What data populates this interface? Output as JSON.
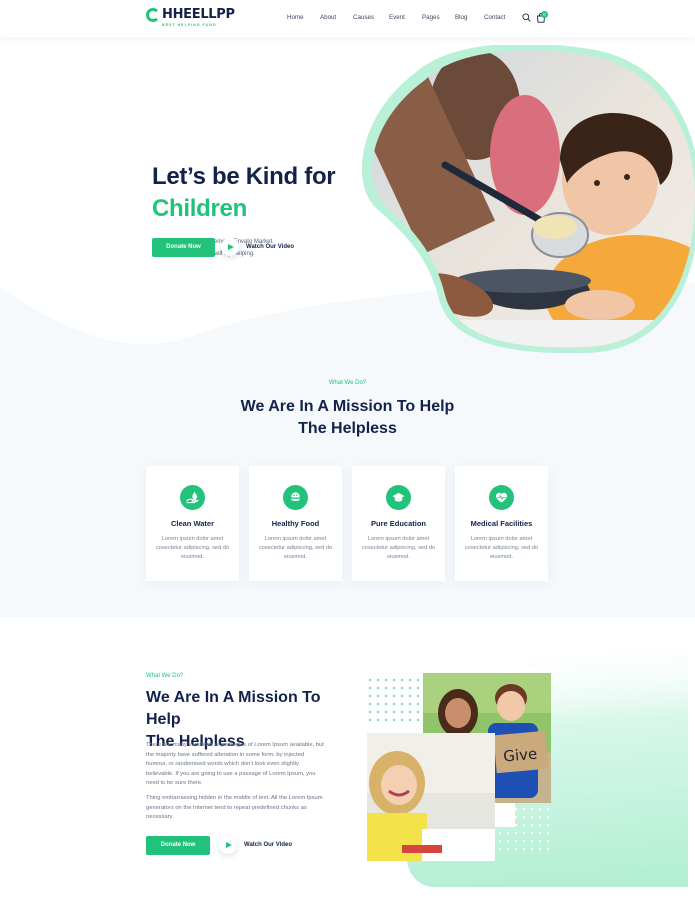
{
  "brand": {
    "name": "HHEELLPP",
    "tagline": "BEST HELPING FUND",
    "accent": "#22c27a",
    "navy": "#13224b",
    "mint": "#b8f0d8"
  },
  "nav": {
    "items": [
      "Home",
      "About",
      "Causes",
      "Event",
      "Pages",
      "Blog",
      "Contact"
    ],
    "cart_count": "0",
    "search_icon": "search-icon",
    "cart_icon": "shopping-bag-icon"
  },
  "hero": {
    "title_line1": "Let’s be Kind for",
    "title_line2": "Children",
    "subtitle_line1": "High Quality Charity Theme in Envato Market.",
    "subtitle_line2": "You Can Satisfied Yourself By Helping.",
    "cta": "Donate Now",
    "video_label": "Watch Our Video"
  },
  "mission": {
    "eyebrow": "What We Do?",
    "title_line1": "We Are In A Mission To Help",
    "title_line2": "The Helpless",
    "cards": [
      {
        "title": "Clean Water",
        "text": "Lorem ipsum dolor amet cosectetur adipiscing, sed do eiusmod.",
        "icon": "water-drop-hand-icon"
      },
      {
        "title": "Healthy Food",
        "text": "Lorem ipsum dolor amet cosectetur adipiscing, sed do eiusmod.",
        "icon": "food-bowl-icon"
      },
      {
        "title": "Pure Education",
        "text": "Lorem ipsum dolor amet cosectetur adipiscing, sed do eiusmod.",
        "icon": "graduation-cap-icon"
      },
      {
        "title": "Medical Facilities",
        "text": "Lorem ipsum dolor amet cosectetur adipiscing, sed do eiusmod.",
        "icon": "heart-pulse-icon"
      }
    ]
  },
  "about": {
    "eyebrow": "What We Do?",
    "title_line1": "We Are In A Mission To Help",
    "title_line2": "The Helpless",
    "paragraph1": "There are many variations of passages of Lorem Ipsum available, but the majority have suffered alteration in some form, by injected humour, or randomised words which don't look even slightly believable. If you are going to use a passage of Lorem Ipsum, you need to be sure there.",
    "paragraph2": "Thing embarrassing hidden in the middle of text. All the Lorem Ipsum generators on the Internet tend to repeat predefined chunks as necessary.",
    "cta": "Donate Now",
    "video_label": "Watch Our Video",
    "sign_text": "Give"
  }
}
